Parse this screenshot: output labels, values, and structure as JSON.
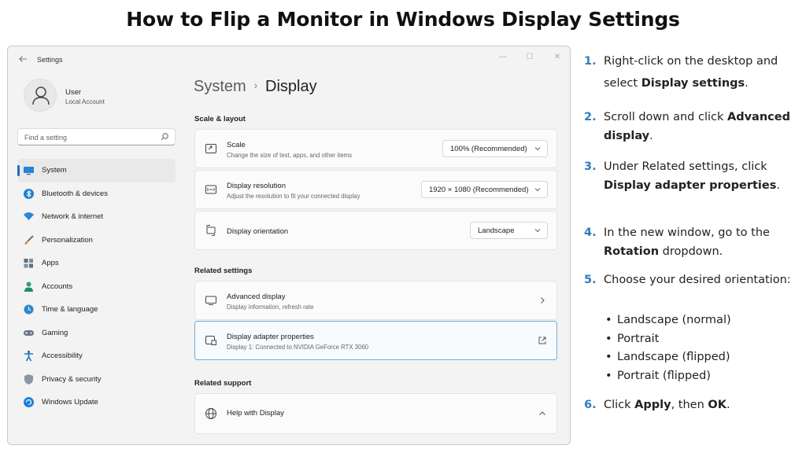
{
  "page": {
    "title": "How to Flip a Monitor in Windows Display Settings"
  },
  "window": {
    "app_title": "Settings",
    "controls": {
      "minimize": "—",
      "maximize": "☐",
      "close": "✕"
    }
  },
  "profile": {
    "name": "User",
    "account": "Local Account"
  },
  "search": {
    "placeholder": "Find a setting"
  },
  "sidebar": {
    "items": [
      {
        "label": "System",
        "icon": "system-icon",
        "active": true
      },
      {
        "label": "Bluetooth & devices",
        "icon": "bluetooth-icon"
      },
      {
        "label": "Network & internet",
        "icon": "wifi-icon"
      },
      {
        "label": "Personalization",
        "icon": "brush-icon"
      },
      {
        "label": "Apps",
        "icon": "apps-icon"
      },
      {
        "label": "Accounts",
        "icon": "person-icon"
      },
      {
        "label": "Time & language",
        "icon": "globe-clock-icon"
      },
      {
        "label": "Gaming",
        "icon": "gamepad-icon"
      },
      {
        "label": "Accessibility",
        "icon": "accessibility-icon"
      },
      {
        "label": "Privacy & security",
        "icon": "shield-icon"
      },
      {
        "label": "Windows Update",
        "icon": "update-icon"
      }
    ]
  },
  "breadcrumb": {
    "parent": "System",
    "separator": "›",
    "current": "Display"
  },
  "scale_layout": {
    "heading": "Scale & layout",
    "scale": {
      "title": "Scale",
      "subtitle": "Change the size of text, apps, and other items",
      "value": "100% (Recommended)"
    },
    "resolution": {
      "title": "Display resolution",
      "subtitle": "Adjust the resolution to fit your connected display",
      "value": "1920 × 1080 (Recommended)"
    },
    "orientation": {
      "title": "Display orientation",
      "value": "Landscape"
    }
  },
  "related_settings": {
    "heading": "Related settings",
    "advanced": {
      "title": "Advanced display",
      "subtitle": "Display information, refresh rate"
    },
    "adapter": {
      "title": "Display adapter properties",
      "subtitle": "Display 1: Connected to NVIDIA GeForce RTX 3060"
    }
  },
  "related_support": {
    "heading": "Related support",
    "help": {
      "title": "Help with Display"
    }
  },
  "steps": [
    {
      "num": "1.",
      "text": "Right-click on the desktop and select ",
      "bold": "Display settings",
      "after": "."
    },
    {
      "num": "2.",
      "text": "Scroll down and click ",
      "bold": "Advanced display",
      "after": "."
    },
    {
      "num": "3.",
      "text": "Under Related settings, click ",
      "bold": "Display adapter properties",
      "after": "."
    },
    {
      "num": "4.",
      "text": "In the new window, go to the ",
      "bold": "Rotation",
      "after": " dropdown."
    },
    {
      "num": "5.",
      "text": "Choose your desired orientation:"
    },
    {
      "num": "6.",
      "text": "Click ",
      "bold": "Apply",
      "mid": ", then ",
      "bold2": "OK",
      "after": "."
    }
  ],
  "orientation_options": [
    "Landscape (normal)",
    "Portrait",
    "Landscape (flipped)",
    "Portrait (flipped)"
  ],
  "colors": {
    "accent": "#2f7cc1",
    "nav_indicator": "#1f6fc0",
    "highlight_border": "#6faed8"
  }
}
